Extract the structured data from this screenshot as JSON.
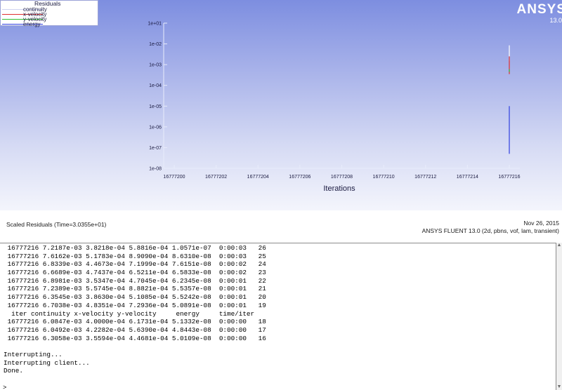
{
  "legend": {
    "title": "Residuals",
    "entries": [
      {
        "name": "continuity",
        "color": "#ffffff"
      },
      {
        "name": "x-velocity",
        "color": "#e03030"
      },
      {
        "name": "y-velocity",
        "color": "#30c030"
      },
      {
        "name": "energy",
        "color": "#3040e0"
      }
    ]
  },
  "brand": {
    "name": "ANSYS",
    "version": "13.0"
  },
  "plot": {
    "title": "Scaled Residuals  (Time=3.0355e+01)",
    "date": "Nov 26, 2015",
    "info": "ANSYS FLUENT 13.0 (2d, pbns, vof, lam, transient)"
  },
  "chart_data": {
    "type": "line",
    "title": "Scaled Residuals  (Time=3.0355e+01)",
    "xlabel": "Iterations",
    "ylabel": "",
    "x_ticks": [
      "16777200",
      "16777202",
      "16777204",
      "16777206",
      "16777208",
      "16777210",
      "16777212",
      "16777214",
      "16777216"
    ],
    "y_ticks": [
      "1e+01",
      "1e-02",
      "1e-03",
      "1e-04",
      "1e-05",
      "1e-06",
      "1e-07",
      "1e-08"
    ],
    "y_scale": "log",
    "xlim": [
      16777200,
      16777216
    ],
    "ylim": [
      1e-08,
      0.1
    ],
    "grid": false,
    "series": [
      {
        "name": "continuity",
        "color": "#ffffff",
        "x": [
          16777216,
          16777216
        ],
        "y": [
          0.0085,
          0.0015
        ]
      },
      {
        "name": "x-velocity",
        "color": "#e03030",
        "x": [
          16777216,
          16777216
        ],
        "y": [
          0.0025,
          0.00035
        ]
      },
      {
        "name": "y-velocity",
        "color": "#30c030",
        "x": [
          16777216,
          16777216
        ],
        "y": [
          0.0006,
          0.00045
        ]
      },
      {
        "name": "energy",
        "color": "#3040e0",
        "x": [
          16777216,
          16777216
        ],
        "y": [
          1e-05,
          5e-08
        ]
      }
    ]
  },
  "console": {
    "lines": [
      " 16777216 7.2187e-03 3.8218e-04 5.8816e-04 1.0571e-07  0:00:03   26",
      " 16777216 7.6162e-03 5.1783e-04 8.9090e-04 8.6310e-08  0:00:03   25",
      " 16777216 6.8339e-03 4.4673e-04 7.1999e-04 7.6151e-08  0:00:02   24",
      " 16777216 6.6689e-03 4.7437e-04 6.5211e-04 6.5833e-08  0:00:02   23",
      " 16777216 6.8981e-03 3.5347e-04 4.7045e-04 6.2345e-08  0:00:01   22",
      " 16777216 7.2389e-03 5.5745e-04 8.8821e-04 5.5357e-08  0:00:01   21",
      " 16777216 6.3545e-03 3.8630e-04 5.1085e-04 5.5242e-08  0:00:01   20",
      " 16777216 6.7038e-03 4.8351e-04 7.2936e-04 5.0891e-08  0:00:01   19",
      "  iter continuity x-velocity y-velocity     energy     time/iter",
      " 16777216 6.0847e-03 4.0000e-04 6.1731e-04 5.1332e-08  0:00:00   18",
      " 16777216 6.0492e-03 4.2282e-04 5.6390e-04 4.8443e-08  0:00:00   17",
      " 16777216 6.3058e-03 3.5594e-04 4.4681e-04 5.0109e-08  0:00:00   16",
      "",
      "Interrupting...",
      "Interrupting client...",
      "Done."
    ],
    "prompt": ">"
  }
}
